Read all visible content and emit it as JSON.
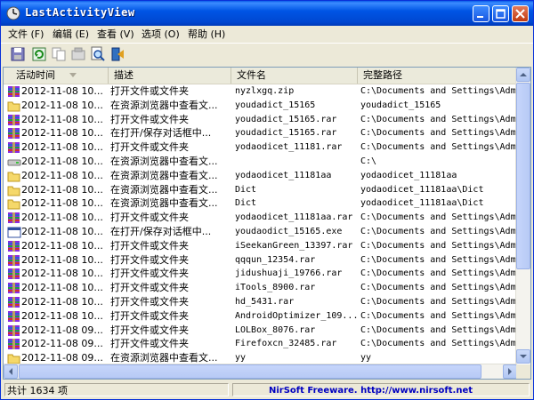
{
  "window": {
    "title": "LastActivityView"
  },
  "menu": [
    "文件 (F)",
    "编辑 (E)",
    "查看 (V)",
    "选项 (O)",
    "帮助 (H)"
  ],
  "toolbar": [
    "save-icon",
    "refresh-icon",
    "copy-icon",
    "properties-icon",
    "find-icon",
    "exit-icon"
  ],
  "columns": [
    "活动时间",
    "描述",
    "文件名",
    "完整路径"
  ],
  "sort_column": "活动时间",
  "rows": [
    {
      "icon": "rar",
      "time": "2012-11-08 10...",
      "desc": "打开文件或文件夹",
      "file": "nyzlxgq.zip",
      "path": "C:\\Documents and Settings\\Admin"
    },
    {
      "icon": "folder",
      "time": "2012-11-08 10...",
      "desc": "在资源浏览器中查看文...",
      "file": "youdadict_15165",
      "path": "youdadict_15165"
    },
    {
      "icon": "rar",
      "time": "2012-11-08 10...",
      "desc": "打开文件或文件夹",
      "file": "youdadict_15165.rar",
      "path": "C:\\Documents and Settings\\Admin"
    },
    {
      "icon": "rar",
      "time": "2012-11-08 10...",
      "desc": "在打开/保存对话框中...",
      "file": "youdadict_15165.rar",
      "path": "C:\\Documents and Settings\\Admin"
    },
    {
      "icon": "rar",
      "time": "2012-11-08 10...",
      "desc": "打开文件或文件夹",
      "file": "yodaodicet_11181.rar",
      "path": "C:\\Documents and Settings\\Admin"
    },
    {
      "icon": "drive",
      "time": "2012-11-08 10...",
      "desc": "在资源浏览器中查看文...",
      "file": "",
      "path": "C:\\"
    },
    {
      "icon": "folder",
      "time": "2012-11-08 10...",
      "desc": "在资源浏览器中查看文...",
      "file": "yodaodicet_11181aa",
      "path": "yodaodicet_11181aa"
    },
    {
      "icon": "folder",
      "time": "2012-11-08 10...",
      "desc": "在资源浏览器中查看文...",
      "file": "Dict",
      "path": "yodaodicet_11181aa\\Dict"
    },
    {
      "icon": "folder",
      "time": "2012-11-08 10...",
      "desc": "在资源浏览器中查看文...",
      "file": "Dict",
      "path": "yodaodicet_11181aa\\Dict"
    },
    {
      "icon": "rar",
      "time": "2012-11-08 10...",
      "desc": "打开文件或文件夹",
      "file": "yodaodicet_11181aa.rar",
      "path": "C:\\Documents and Settings\\Admin"
    },
    {
      "icon": "exe",
      "time": "2012-11-08 10...",
      "desc": "在打开/保存对话框中...",
      "file": "youdaodict_15165.exe",
      "path": "C:\\Documents and Settings\\Admin"
    },
    {
      "icon": "rar",
      "time": "2012-11-08 10...",
      "desc": "打开文件或文件夹",
      "file": "iSeekanGreen_13397.rar",
      "path": "C:\\Documents and Settings\\Admin"
    },
    {
      "icon": "rar",
      "time": "2012-11-08 10...",
      "desc": "打开文件或文件夹",
      "file": "qqqun_12354.rar",
      "path": "C:\\Documents and Settings\\Admin"
    },
    {
      "icon": "rar",
      "time": "2012-11-08 10...",
      "desc": "打开文件或文件夹",
      "file": "jidushuaji_19766.rar",
      "path": "C:\\Documents and Settings\\Admin"
    },
    {
      "icon": "rar",
      "time": "2012-11-08 10...",
      "desc": "打开文件或文件夹",
      "file": "iTools_8900.rar",
      "path": "C:\\Documents and Settings\\Admin"
    },
    {
      "icon": "rar",
      "time": "2012-11-08 10...",
      "desc": "打开文件或文件夹",
      "file": "hd_5431.rar",
      "path": "C:\\Documents and Settings\\Admin"
    },
    {
      "icon": "rar",
      "time": "2012-11-08 10...",
      "desc": "打开文件或文件夹",
      "file": "AndroidOptimizer_109...",
      "path": "C:\\Documents and Settings\\Admin"
    },
    {
      "icon": "rar",
      "time": "2012-11-08 09...",
      "desc": "打开文件或文件夹",
      "file": "LOLBox_8076.rar",
      "path": "C:\\Documents and Settings\\Admin"
    },
    {
      "icon": "rar",
      "time": "2012-11-08 09...",
      "desc": "打开文件或文件夹",
      "file": "Firefoxcn_32485.rar",
      "path": "C:\\Documents and Settings\\Admin"
    },
    {
      "icon": "folder",
      "time": "2012-11-08 09...",
      "desc": "在资源浏览器中查看文...",
      "file": "yy",
      "path": "yy"
    }
  ],
  "status": {
    "count": "共计 1634 项",
    "credit": "NirSoft Freeware.  http://www.nirsoft.net"
  }
}
